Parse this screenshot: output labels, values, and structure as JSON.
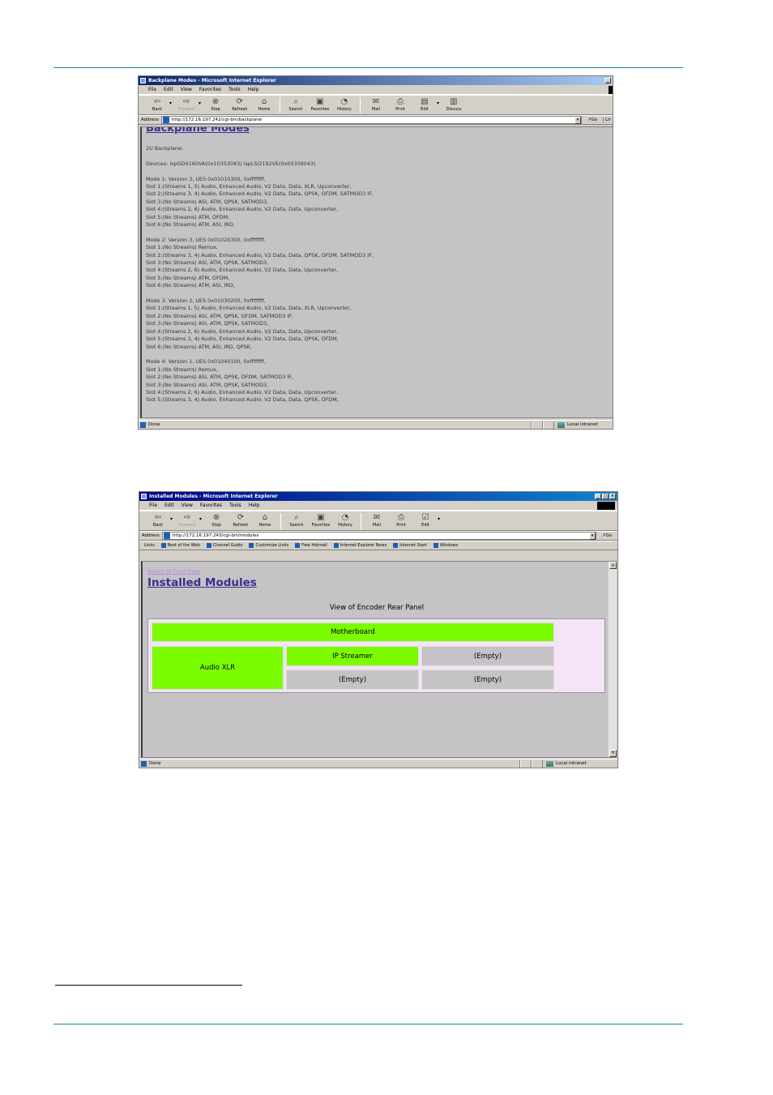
{
  "figure1": {
    "window_title": "Backplane Modes - Microsoft Internet Explorer",
    "menu": [
      "File",
      "Edit",
      "View",
      "Favorites",
      "Tools",
      "Help"
    ],
    "toolbar": [
      {
        "label": "Back",
        "icon": "back-arrow-icon"
      },
      {
        "label": "Forward",
        "icon": "forward-arrow-icon",
        "disabled": true
      },
      {
        "label": "Stop",
        "icon": "stop-icon"
      },
      {
        "label": "Refresh",
        "icon": "refresh-icon"
      },
      {
        "label": "Home",
        "icon": "home-icon"
      },
      {
        "label": "Search",
        "icon": "search-icon"
      },
      {
        "label": "Favorites",
        "icon": "favorites-icon"
      },
      {
        "label": "History",
        "icon": "history-icon"
      },
      {
        "label": "Mail",
        "icon": "mail-icon"
      },
      {
        "label": "Print",
        "icon": "print-icon"
      },
      {
        "label": "Edit",
        "icon": "edit-icon"
      },
      {
        "label": "Discuss",
        "icon": "discuss-icon"
      }
    ],
    "address_label": "Address",
    "url": "http://172.16.197.242/cgi-bin/backplane",
    "go_label": "Go",
    "links_label": "Lir",
    "heading": "Backplane Modes",
    "backplane_label": "2U Backplane:",
    "devices": "Devices: ispGDX160VA(0x10353043) ispLSI2192VE(0x00309043)",
    "modes": [
      {
        "header": "Mode 1: Version 3, UES 0x01010300, 0xffffffff,",
        "slots": [
          "Slot 1:(Streams 1, 5) Audio, Enhanced Audio, V2 Data, Data, XLR, Upconverter,",
          "Slot 2:(Streams 3, 4) Audio, Enhanced Audio, V2 Data, Data, QPSK, OFDM, SATMOD3 IF,",
          "Slot 3:(No Streams) ASI, ATM, QPSK, SATMOD3,",
          "Slot 4:(Streams 2, 6) Audio, Enhanced Audio, V2 Data, Data, Upconverter,",
          "Slot 5:(No Streams) ATM, OFDM,",
          "Slot 6:(No Streams) ATM, ASI, IRD,"
        ]
      },
      {
        "header": "Mode 2: Version 3, UES 0x01020300, 0xffffffff,",
        "slots": [
          "Slot 1:(No Streams) Remux,",
          "Slot 2:(Streams 3, 4) Audio, Enhanced Audio, V2 Data, Data, QPSK, OFDM, SATMOD3 IF,",
          "Slot 3:(No Streams) ASI, ATM, QPSK, SATMOD3,",
          "Slot 4:(Streams 2, 6) Audio, Enhanced Audio, V2 Data, Data, Upconverter,",
          "Slot 5:(No Streams) ATM, OFDM,",
          "Slot 6:(No Streams) ATM, ASI, IRD,"
        ]
      },
      {
        "header": "Mode 3: Version 2, UES 0x01030200, 0xffffffff,",
        "slots": [
          "Slot 1:(Streams 1, 5) Audio, Enhanced Audio, V2 Data, Data, XLR, Upconverter,",
          "Slot 2:(No Streams) ASI, ATM, QPSK, OFDM, SATMOD3 IF,",
          "Slot 3:(No Streams) ASI, ATM, QPSK, SATMOD3,",
          "Slot 4:(Streams 2, 6) Audio, Enhanced Audio, V2 Data, Data, Upconverter,",
          "Slot 5:(Streams 3, 4) Audio, Enhanced Audio, V2 Data, Data, QPSK, OFDM,",
          "Slot 6:(No Streams) ATM, ASI, IRD, QPSK,"
        ]
      },
      {
        "header": "Mode 4: Version 1, UES 0x01040100, 0xffffffff,",
        "slots": [
          "Slot 1:(No Streams) Remux,",
          "Slot 2:(No Streams) ASI, ATM, QPSK, OFDM, SATMOD3 IF,",
          "Slot 3:(No Streams) ASI, ATM, QPSK, SATMOD3,",
          "Slot 4:(Streams 2, 6) Audio, Enhanced Audio, V2 Data, Data, Upconverter,",
          "Slot 5:(Streams 3, 4) Audio, Enhanced Audio, V2 Data, Data, QPSK, OFDM,"
        ]
      }
    ],
    "status": "Done",
    "zone": "Local intranet"
  },
  "figure2": {
    "window_title": "Installed Modules - Microsoft Internet Explorer",
    "menu": [
      "File",
      "Edit",
      "View",
      "Favorites",
      "Tools",
      "Help"
    ],
    "toolbar": [
      {
        "label": "Back",
        "icon": "back-arrow-icon"
      },
      {
        "label": "Forward",
        "icon": "forward-arrow-icon",
        "disabled": true
      },
      {
        "label": "Stop",
        "icon": "stop-icon"
      },
      {
        "label": "Refresh",
        "icon": "refresh-icon"
      },
      {
        "label": "Home",
        "icon": "home-icon"
      },
      {
        "label": "Search",
        "icon": "search-icon"
      },
      {
        "label": "Favorites",
        "icon": "favorites-icon"
      },
      {
        "label": "History",
        "icon": "history-icon"
      },
      {
        "label": "Mail",
        "icon": "mail-icon"
      },
      {
        "label": "Print",
        "icon": "print-icon"
      },
      {
        "label": "Edit",
        "icon": "edit-icon"
      }
    ],
    "address_label": "Address",
    "url": "http://172.16.197.243/cgi-bin/modules",
    "go_label": "Go",
    "links_label": "Links",
    "links": [
      "Best of the Web",
      "Channel Guide",
      "Customize Links",
      "Free Hotmail",
      "Internet Explorer News",
      "Internet Start",
      "Windows"
    ],
    "back_link": "Return to Front Page",
    "heading": "Installed Modules",
    "caption": "View of Encoder Rear Panel",
    "modules": {
      "motherboard": {
        "label": "Motherboard",
        "installed": true
      },
      "left": {
        "label": "Audio XLR",
        "installed": true
      },
      "top_middle": {
        "label": "IP Streamer",
        "installed": true
      },
      "top_right": {
        "label": "(Empty)",
        "installed": false
      },
      "bottom_middle": {
        "label": "(Empty)",
        "installed": false
      },
      "bottom_right": {
        "label": "(Empty)",
        "installed": false
      }
    },
    "colors": {
      "installed": "#7cfc00",
      "empty": "#c6c3c6",
      "panel": "#f4e4f6"
    },
    "status": "Done",
    "zone": "Local intranet"
  }
}
